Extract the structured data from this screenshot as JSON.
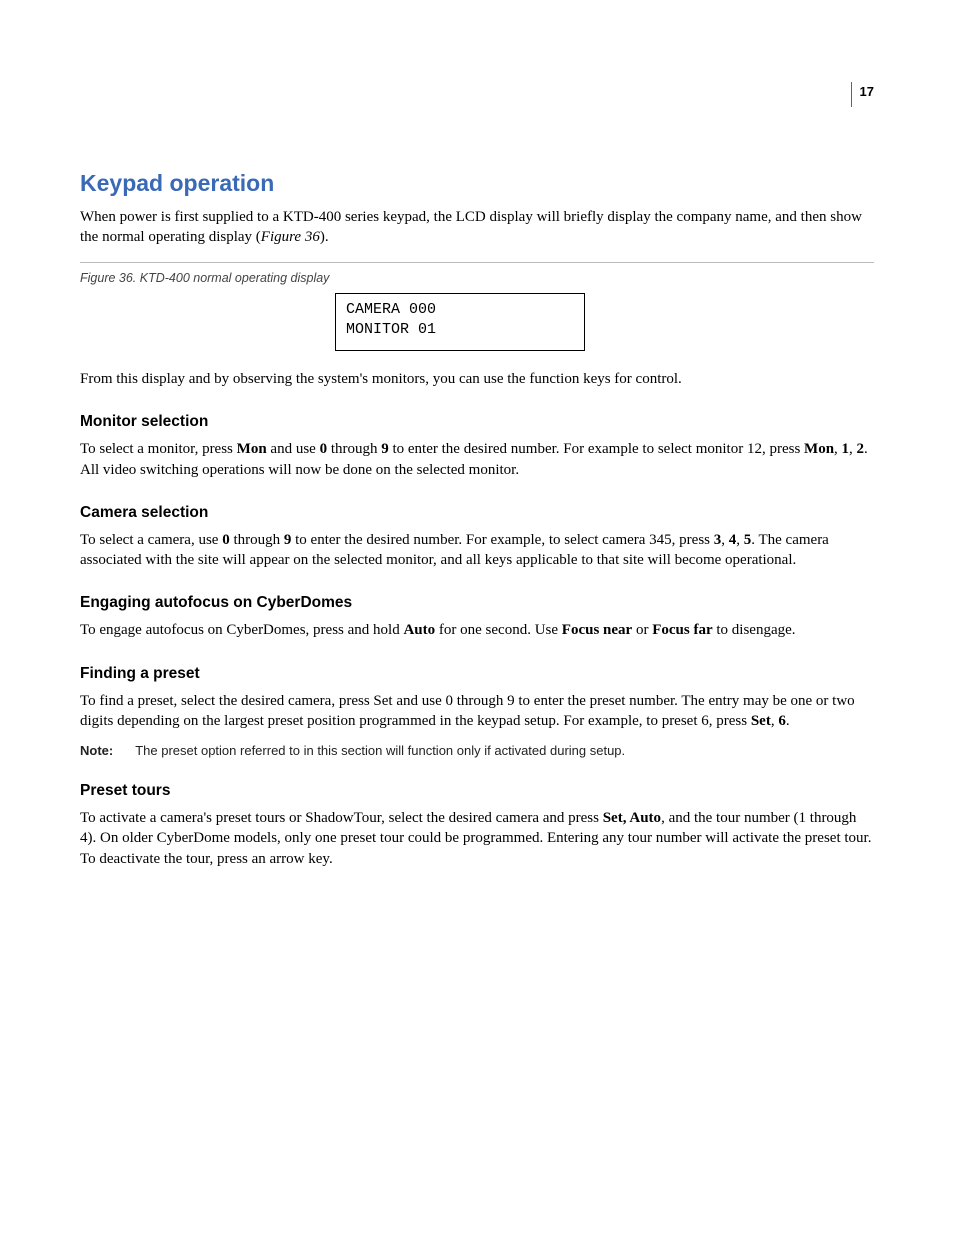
{
  "page_number": "17",
  "h1": "Keypad operation",
  "intro_parts": {
    "a": "When power is first supplied to a KTD-400 series keypad, the LCD display will briefly display the company name, and then show the normal operating display (",
    "fig_ref": "Figure 36",
    "b": ")."
  },
  "figure_caption": "Figure 36.  KTD-400 normal operating display",
  "lcd_line1": "CAMERA 000",
  "lcd_line2": "MONITOR 01",
  "after_figure": "From this display and by observing the system's monitors, you can use the function keys for control.",
  "sections": {
    "monitor": {
      "heading": "Monitor selection",
      "p": {
        "a": "To select a monitor, press ",
        "b1": "Mon",
        "c": " and use ",
        "b2": "0",
        "d": " through ",
        "b3": "9",
        "e": " to enter the desired number.  For example to select monitor 12, press ",
        "b4": "Mon",
        "f": ", ",
        "b5": "1",
        "g": ", ",
        "b6": "2",
        "h": ".  All video switching operations will now be done on the selected monitor."
      }
    },
    "camera": {
      "heading": "Camera selection",
      "p": {
        "a": "To select a camera, use ",
        "b1": "0",
        "c": " through ",
        "b2": "9",
        "d": " to enter the desired number.  For example, to select camera 345, press ",
        "b3": "3",
        "e": ", ",
        "b4": "4",
        "f": ", ",
        "b5": "5",
        "g": ".  The camera associated with the site will appear on the selected monitor, and all keys applicable to that site will become operational."
      }
    },
    "autofocus": {
      "heading": "Engaging autofocus on CyberDomes",
      "p": {
        "a": "To engage autofocus on CyberDomes, press and hold ",
        "b1": "Auto",
        "c": " for one second.  Use ",
        "b2": "Focus near",
        "d": " or ",
        "b3": "Focus far",
        "e": " to disengage."
      }
    },
    "preset": {
      "heading": "Finding a preset",
      "p": {
        "a": "To find a preset, select the desired camera, press Set and use 0 through 9 to enter the preset number.  The entry may be one or two digits depending on the largest preset position programmed in the keypad setup.  For example, to preset 6, press ",
        "b1": "Set",
        "c": ", ",
        "b2": "6",
        "d": "."
      },
      "note_label": "Note:",
      "note_text": "The preset option referred to in this section will function only if activated during setup."
    },
    "tours": {
      "heading": "Preset tours",
      "p": {
        "a": "To activate a camera's preset tours or ShadowTour, select the desired camera and press ",
        "b1": "Set, Auto",
        "c": ", and the tour number (1 through 4).  On older CyberDome models, only one preset tour could be programmed.  Entering any tour number will activate the preset tour.  To deactivate the tour, press an arrow key."
      }
    }
  }
}
